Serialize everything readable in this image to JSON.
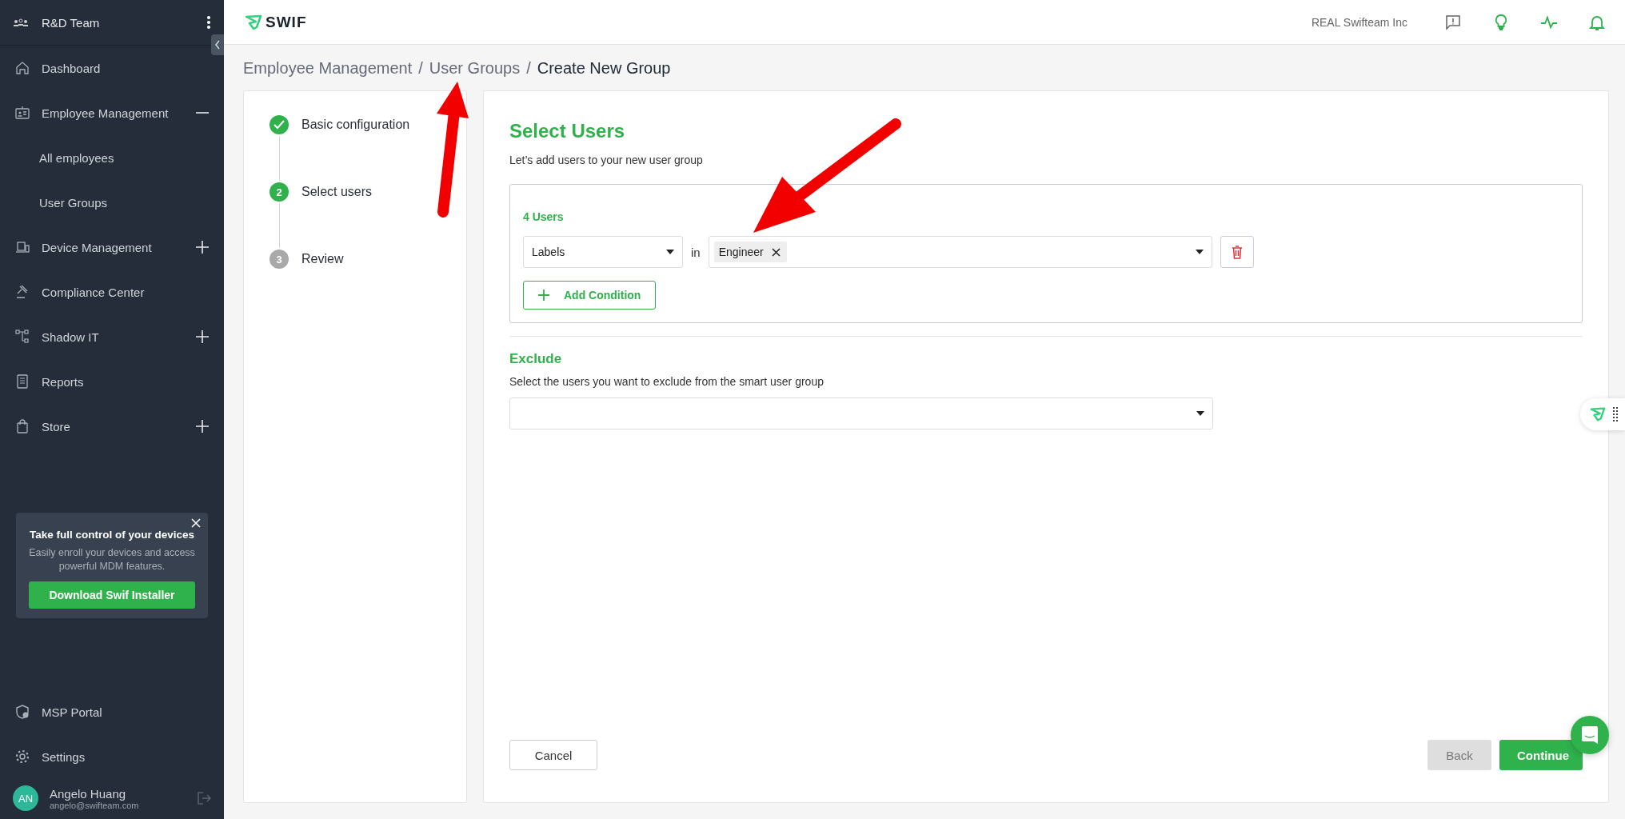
{
  "sidebar": {
    "team": "R&D Team",
    "items": [
      {
        "label": "Dashboard"
      },
      {
        "label": "Employee Management",
        "expanded": true,
        "children": [
          {
            "label": "All employees"
          },
          {
            "label": "User Groups"
          }
        ]
      },
      {
        "label": "Device Management",
        "expanded": false
      },
      {
        "label": "Compliance Center"
      },
      {
        "label": "Shadow IT",
        "expanded": false
      },
      {
        "label": "Reports"
      },
      {
        "label": "Store",
        "expanded": false
      }
    ],
    "promo": {
      "title": "Take full control of your devices",
      "text": "Easily enroll your devices and access powerful MDM features.",
      "button": "Download Swif Installer"
    },
    "bottom_items": [
      {
        "label": "MSP Portal"
      },
      {
        "label": "Settings"
      }
    ],
    "user": {
      "initials": "AN",
      "name": "Angelo Huang",
      "email": "angelo@swifteam.com"
    }
  },
  "header": {
    "logo": "SWIF",
    "company": "REAL Swifteam Inc"
  },
  "breadcrumb": {
    "separator": "/",
    "items": [
      "Employee Management",
      "User Groups",
      "Create New Group"
    ]
  },
  "steps": [
    {
      "label": "Basic configuration",
      "completed": true
    },
    {
      "number": "2",
      "label": "Select users",
      "completed": false,
      "active": true
    },
    {
      "number": "3",
      "label": "Review",
      "completed": false,
      "active": false
    }
  ],
  "form": {
    "title": "Select Users",
    "subtitle": "Let’s add users to your new user group",
    "user_count": "4 Users",
    "condition": {
      "field": "Labels",
      "operator": "in",
      "tags": [
        {
          "label": "Engineer"
        }
      ]
    },
    "add_button": "Add Condition",
    "exclude": {
      "title": "Exclude",
      "description": "Select the users you want to exclude from the smart user group"
    }
  },
  "buttons": [
    {
      "label": "Cancel",
      "kind": "outline",
      "disabled": false
    },
    {
      "label": "Back",
      "kind": "secondary",
      "disabled": true
    },
    {
      "label": "Continue",
      "kind": "primary",
      "disabled": false
    }
  ]
}
